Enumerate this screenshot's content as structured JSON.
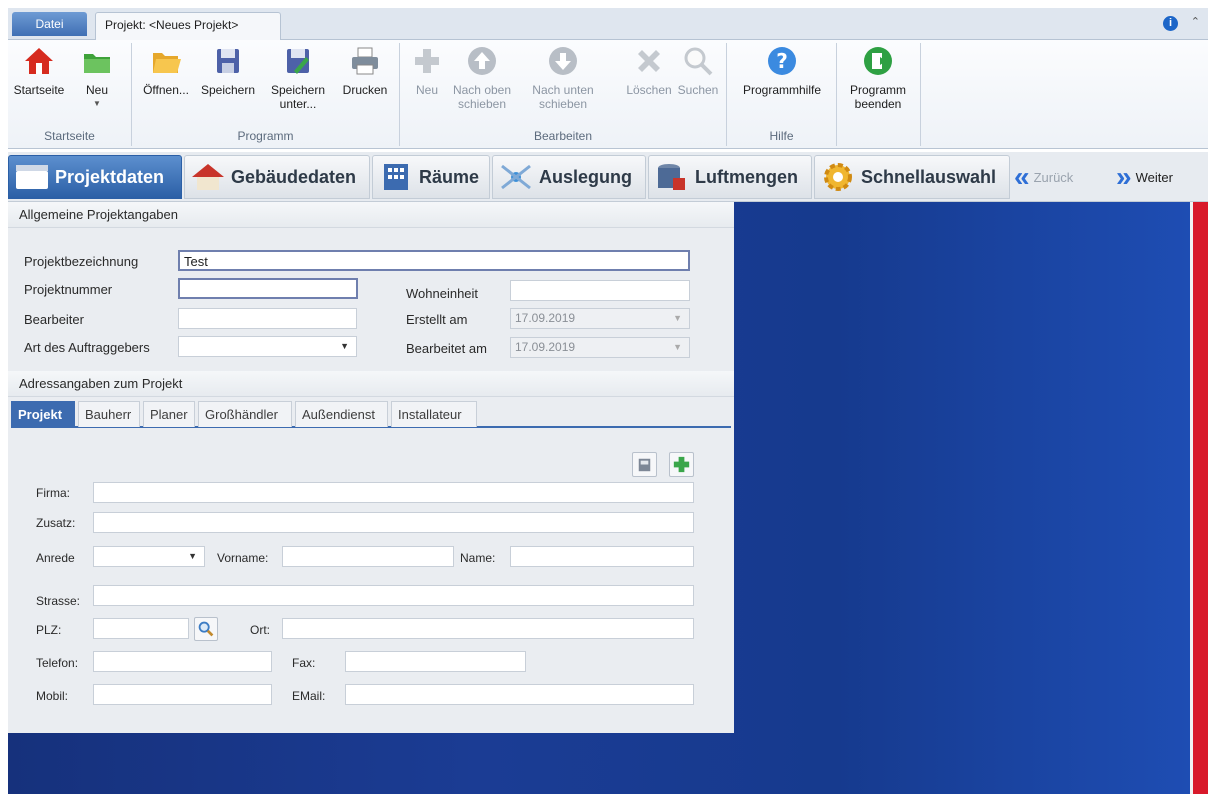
{
  "ribbon_tabs": {
    "file": "Datei",
    "project": "Projekt: <Neues Projekt>"
  },
  "ribbon": {
    "startseite": {
      "label": "Startseite",
      "buttons": [
        "Startseite",
        "Neu"
      ]
    },
    "programm": {
      "label": "Programm",
      "buttons": [
        "Öffnen...",
        "Speichern",
        "Speichern unter...",
        "Drucken"
      ]
    },
    "bearbeiten": {
      "label": "Bearbeiten",
      "buttons": [
        "Neu",
        "Nach oben schieben",
        "Nach unten schieben",
        "Löschen",
        "Suchen"
      ]
    },
    "hilfe": {
      "label": "Hilfe",
      "buttons": [
        "Programmhilfe"
      ]
    },
    "beenden": {
      "buttons": [
        "Programm beenden"
      ]
    }
  },
  "nav": {
    "tabs": [
      "Projektdaten",
      "Gebäudedaten",
      "Räume",
      "Auslegung",
      "Luftmengen",
      "Schnellauswahl"
    ],
    "back": "Zurück",
    "next": "Weiter"
  },
  "general": {
    "title": "Allgemeine Projektangaben",
    "projektbezeichnung": {
      "label": "Projektbezeichnung",
      "value": "Test"
    },
    "projektnummer": {
      "label": "Projektnummer",
      "value": ""
    },
    "bearbeiter": {
      "label": "Bearbeiter",
      "value": ""
    },
    "art": {
      "label": "Art des Auftraggebers",
      "value": ""
    },
    "wohneinheit": {
      "label": "Wohneinheit",
      "value": ""
    },
    "erstellt": {
      "label": "Erstellt am",
      "value": "17.09.2019"
    },
    "bearbeitet": {
      "label": "Bearbeitet am",
      "value": "17.09.2019"
    }
  },
  "address": {
    "title": "Adressangaben zum Projekt",
    "tabs": [
      "Projekt",
      "Bauherr",
      "Planer",
      "Großhändler",
      "Außendienst",
      "Installateur"
    ],
    "labels": {
      "firma": "Firma:",
      "zusatz": "Zusatz:",
      "anrede": "Anrede",
      "vorname": "Vorname:",
      "name": "Name:",
      "strasse": "Strasse:",
      "plz": "PLZ:",
      "ort": "Ort:",
      "telefon": "Telefon:",
      "fax": "Fax:",
      "mobil": "Mobil:",
      "email": "EMail:"
    }
  },
  "colors": {
    "accent": "#3c6bb0",
    "background": "#1b3c94",
    "redbar": "#d8192a"
  }
}
